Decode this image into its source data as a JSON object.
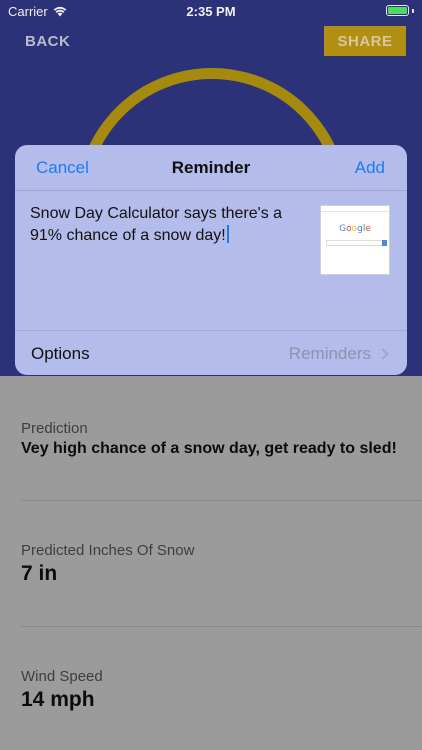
{
  "status_bar": {
    "carrier": "Carrier",
    "time": "2:35 PM",
    "battery_color": "#4cd964"
  },
  "nav": {
    "back_label": "BACK",
    "share_label": "SHARE"
  },
  "share_sheet": {
    "cancel_label": "Cancel",
    "title": "Reminder",
    "add_label": "Add",
    "body_text": "Snow Day Calculator says there's a 91% chance of a snow day!",
    "thumbnail_logo": "Google",
    "options_label": "Options",
    "options_value": "Reminders"
  },
  "info": {
    "prediction": {
      "label": "Prediction",
      "value": "Vey high chance of a snow day, get ready to sled!"
    },
    "snow": {
      "label": "Predicted Inches Of Snow",
      "value": "7 in"
    },
    "wind": {
      "label": "Wind Speed",
      "value": "14 mph"
    }
  },
  "colors": {
    "app_background": "#2b3278",
    "accent_gold": "#b18f12",
    "ios_blue": "#1a7cf5"
  }
}
